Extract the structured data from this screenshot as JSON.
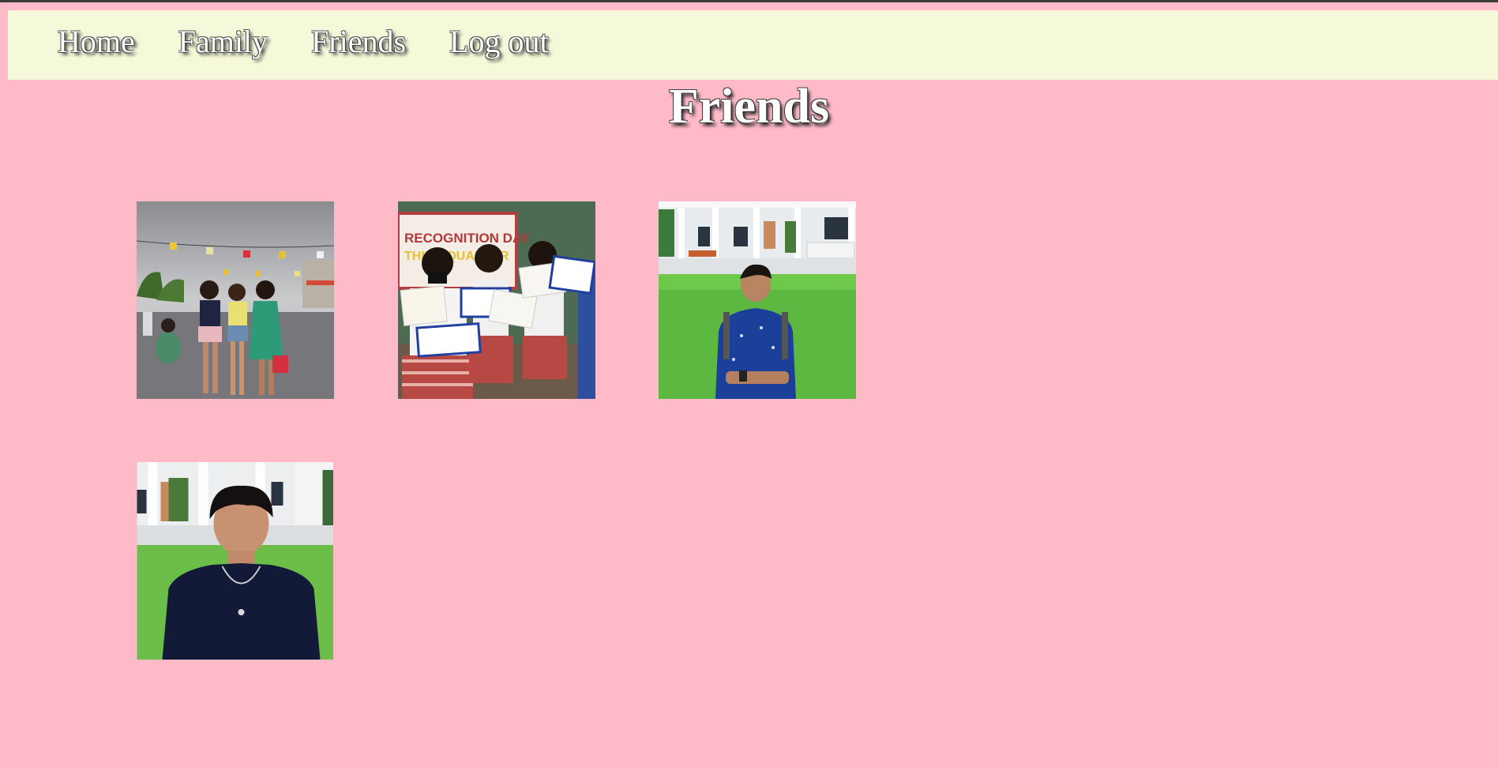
{
  "nav": {
    "items": [
      {
        "label": "Home"
      },
      {
        "label": "Family"
      },
      {
        "label": "Friends"
      },
      {
        "label": "Log out"
      }
    ]
  },
  "page": {
    "title": "Friends"
  },
  "gallery": {
    "photos": [
      {
        "text": []
      },
      {
        "text": [
          "RECOGNITION DAY",
          "THIRD QUARTER"
        ]
      },
      {
        "text": []
      },
      {
        "text": []
      }
    ]
  },
  "colors": {
    "background": "#ffbac8",
    "navbar": "#f6f8da",
    "text": "#ffffff"
  }
}
